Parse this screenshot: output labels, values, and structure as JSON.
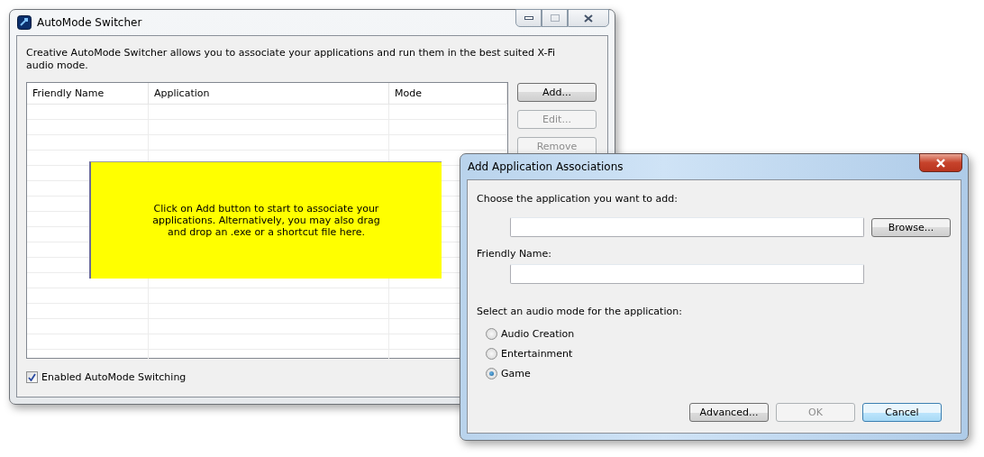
{
  "main_window": {
    "title": "AutoMode Switcher",
    "description": "Creative AutoMode Switcher allows you to associate your applications and run them in the best suited X-Fi audio mode.",
    "table": {
      "columns": [
        "Friendly Name",
        "Application",
        "Mode"
      ],
      "hint": "Click on Add button to start to associate your applications. Alternatively, you may also drag and drop an .exe or a shortcut file here."
    },
    "buttons": [
      {
        "label": "Add...",
        "disabled": false
      },
      {
        "label": "Edit...",
        "disabled": true
      },
      {
        "label": "Remove",
        "disabled": true
      }
    ],
    "checkbox": {
      "label": "Enabled AutoMode Switching",
      "checked": true
    }
  },
  "dialog": {
    "title": "Add Application Associations",
    "application_label": "Choose the application you want to add:",
    "browse_button": "Browse...",
    "friendly_name_label": "Friendly Name:",
    "mode_label": "Select an audio mode for the application:",
    "modes": [
      {
        "label": "Audio Creation",
        "selected": false
      },
      {
        "label": "Entertainment",
        "selected": false
      },
      {
        "label": "Game",
        "selected": true
      }
    ],
    "buttons": [
      {
        "label": "Advanced...",
        "disabled": false,
        "default": false
      },
      {
        "label": "OK",
        "disabled": true,
        "default": false
      },
      {
        "label": "Cancel",
        "disabled": false,
        "default": true
      }
    ]
  }
}
